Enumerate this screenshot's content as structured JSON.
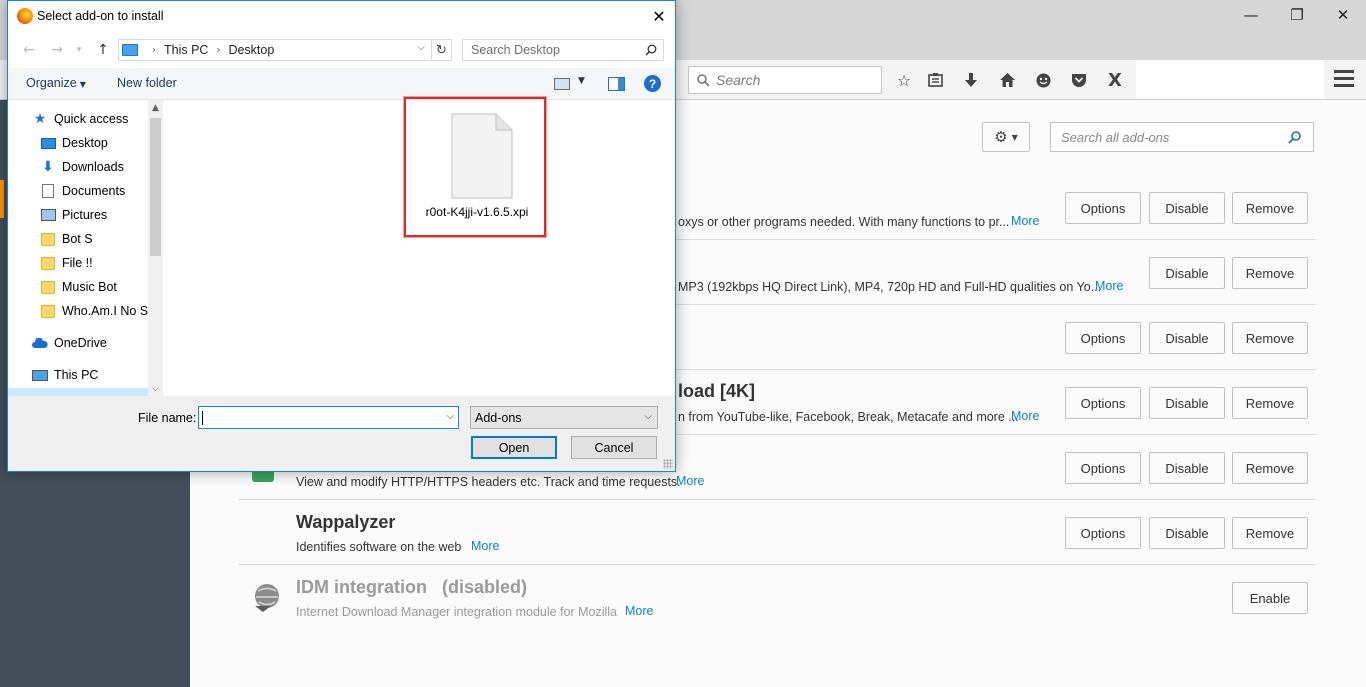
{
  "browser": {
    "window_controls": {
      "minimize": "—",
      "maximize": "❐",
      "close": "✕"
    },
    "search_placeholder": "Search",
    "toolbar_icons": [
      "star-icon",
      "reading-list-icon",
      "download-icon",
      "home-icon",
      "smiley-icon",
      "pocket-icon",
      "x-extension-icon"
    ]
  },
  "addons_page": {
    "search_placeholder": "Search all add-ons",
    "rows": [
      {
        "name": "",
        "description": "oxys or other programs needed. With many functions to pr...",
        "more": "More",
        "buttons": [
          "Options",
          "Disable",
          "Remove"
        ]
      },
      {
        "name": "",
        "description": "MP3 (192kbps HQ Direct Link), MP4, 720p HD and Full-HD qualities on Yo...",
        "more": "More",
        "buttons": [
          "Disable",
          "Remove"
        ]
      },
      {
        "name": "",
        "description": "",
        "more": "",
        "buttons": [
          "Options",
          "Disable",
          "Remove"
        ]
      },
      {
        "name": "load [4K]",
        "description": "n from YouTube-like, Facebook, Break, Metacafe and more ...",
        "more": "More",
        "buttons": [
          "Options",
          "Disable",
          "Remove"
        ]
      },
      {
        "name": "",
        "description": "View and modify HTTP/HTTPS headers etc.  Track and time requests.",
        "more": "More",
        "buttons": [
          "Options",
          "Disable",
          "Remove"
        ]
      },
      {
        "name": "Wappalyzer",
        "description": "Identifies software on the web",
        "more": "More",
        "buttons": [
          "Options",
          "Disable",
          "Remove"
        ]
      },
      {
        "name": "IDM integration",
        "status": "(disabled)",
        "description": "Internet Download Manager integration module for Mozilla",
        "more": "More",
        "buttons": [
          "Enable"
        ]
      }
    ]
  },
  "dialog": {
    "title": "Select add-on to install",
    "breadcrumb": [
      "This PC",
      "Desktop"
    ],
    "search_placeholder": "Search Desktop",
    "toolbar": {
      "organize": "Organize",
      "new_folder": "New folder"
    },
    "nav_pane": [
      {
        "label": "Quick access",
        "icon": "star-icon"
      },
      {
        "label": "Desktop",
        "icon": "desktop-icon",
        "pinned": true
      },
      {
        "label": "Downloads",
        "icon": "download-icon",
        "pinned": true
      },
      {
        "label": "Documents",
        "icon": "documents-icon",
        "pinned": true
      },
      {
        "label": "Pictures",
        "icon": "pictures-icon",
        "pinned": true
      },
      {
        "label": "Bot S",
        "icon": "folder-icon"
      },
      {
        "label": "File !!",
        "icon": "folder-icon"
      },
      {
        "label": "Music Bot",
        "icon": "folder-icon"
      },
      {
        "label": "Who.Am.I No Sy",
        "icon": "folder-icon"
      },
      {
        "label": "OneDrive",
        "icon": "cloud-icon"
      },
      {
        "label": "This PC",
        "icon": "computer-icon"
      }
    ],
    "file": {
      "name": "r0ot-K4jji-v1.6.5.xpi"
    },
    "file_name_label": "File name:",
    "file_name_value": "",
    "file_type": "Add-ons",
    "open_label": "Open",
    "cancel_label": "Cancel"
  }
}
